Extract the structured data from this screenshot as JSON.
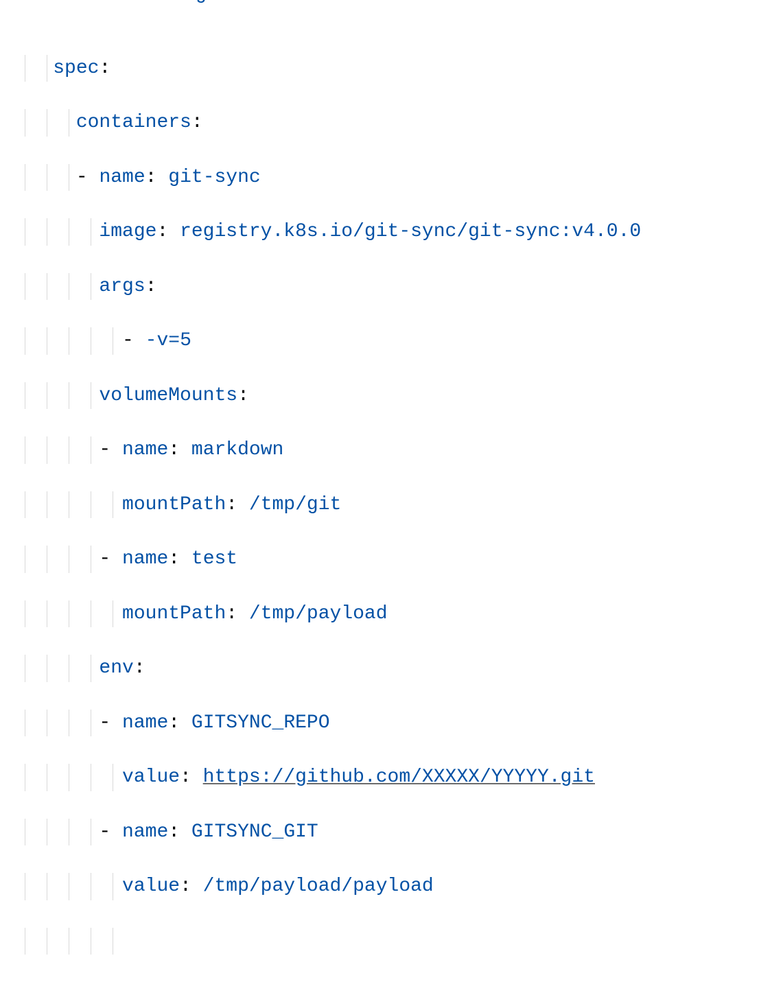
{
  "yaml": {
    "top_fragment_left": "......",
    "top_fragment_right": "---g",
    "spec_key": "spec",
    "containers_key": "containers",
    "name_key": "name",
    "container_name": "git-sync",
    "image_key": "image",
    "image_val": "registry.k8s.io/git-sync/git-sync:v4.0.0",
    "args_key": "args",
    "arg0": "-v=5",
    "volumeMounts_key": "volumeMounts",
    "vm0_name": "markdown",
    "mountPath_key": "mountPath",
    "vm0_path": "/tmp/git",
    "vm1_name": "test",
    "vm1_path": "/tmp/payload",
    "env_key": "env",
    "env0_name": "GITSYNC_REPO",
    "value_key": "value",
    "env0_value": "https://github.com/XXXXX/YYYYY.git",
    "env1_name": "GITSYNC_GIT",
    "env1_value": "/tmp/payload/payload"
  }
}
